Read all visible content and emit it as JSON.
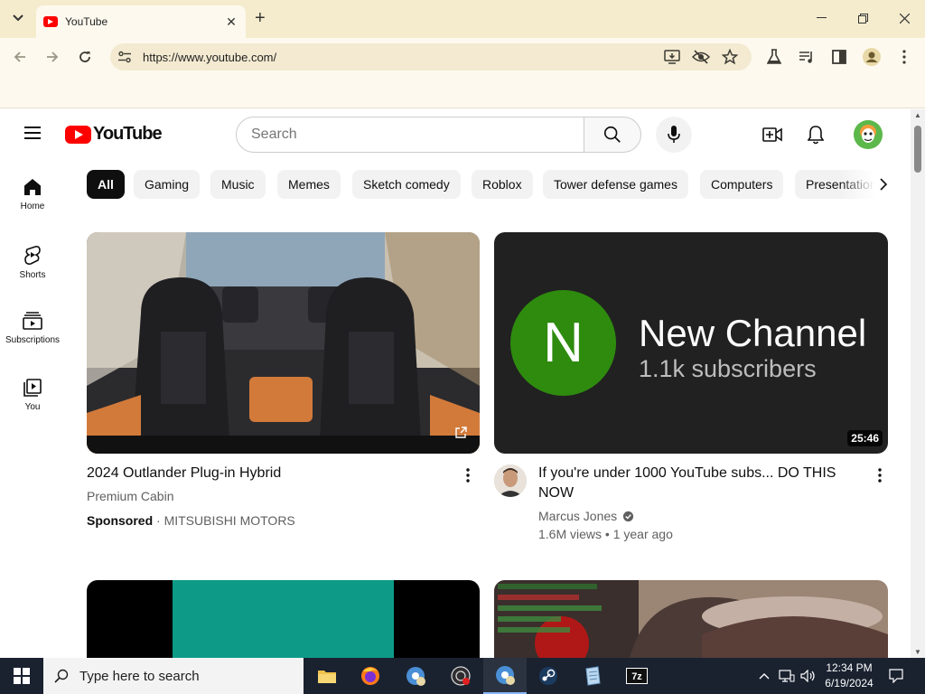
{
  "browser": {
    "tab_title": "YouTube",
    "new_tab_symbol": "+",
    "url": "https://www.youtube.com/"
  },
  "youtube": {
    "logo_text": "YouTube",
    "search_placeholder": "Search",
    "sidebar": [
      {
        "label": "Home",
        "icon": "home-icon"
      },
      {
        "label": "Shorts",
        "icon": "shorts-icon"
      },
      {
        "label": "Subscriptions",
        "icon": "subscriptions-icon"
      },
      {
        "label": "You",
        "icon": "you-icon"
      }
    ],
    "chips": [
      "All",
      "Gaming",
      "Music",
      "Memes",
      "Sketch comedy",
      "Roblox",
      "Tower defense games",
      "Computers",
      "Presentations"
    ],
    "videos": [
      {
        "title": "2024 Outlander Plug-in Hybrid",
        "subtitle": "Premium Cabin",
        "sponsored_label": "Sponsored",
        "advertiser": "MITSUBISHI MOTORS",
        "sep": " · "
      },
      {
        "thumb_letter": "N",
        "thumb_heading": "New Channel",
        "thumb_sub": "1.1k subscribers",
        "duration": "25:46",
        "title_line1": "If you're under 1000 YouTube subs... DO THIS",
        "title_line2": "NOW",
        "channel": "Marcus Jones",
        "stats": "1.6M views • 1 year ago"
      }
    ]
  },
  "taskbar": {
    "search_placeholder": "Type here to search",
    "time": "12:34 PM",
    "date": "6/19/2024"
  },
  "colors": {
    "brand_red": "#ff0000",
    "chrome_bg": "#f5eccd",
    "channel_green": "#2e8b0e",
    "taskbar": "#1a2230"
  }
}
